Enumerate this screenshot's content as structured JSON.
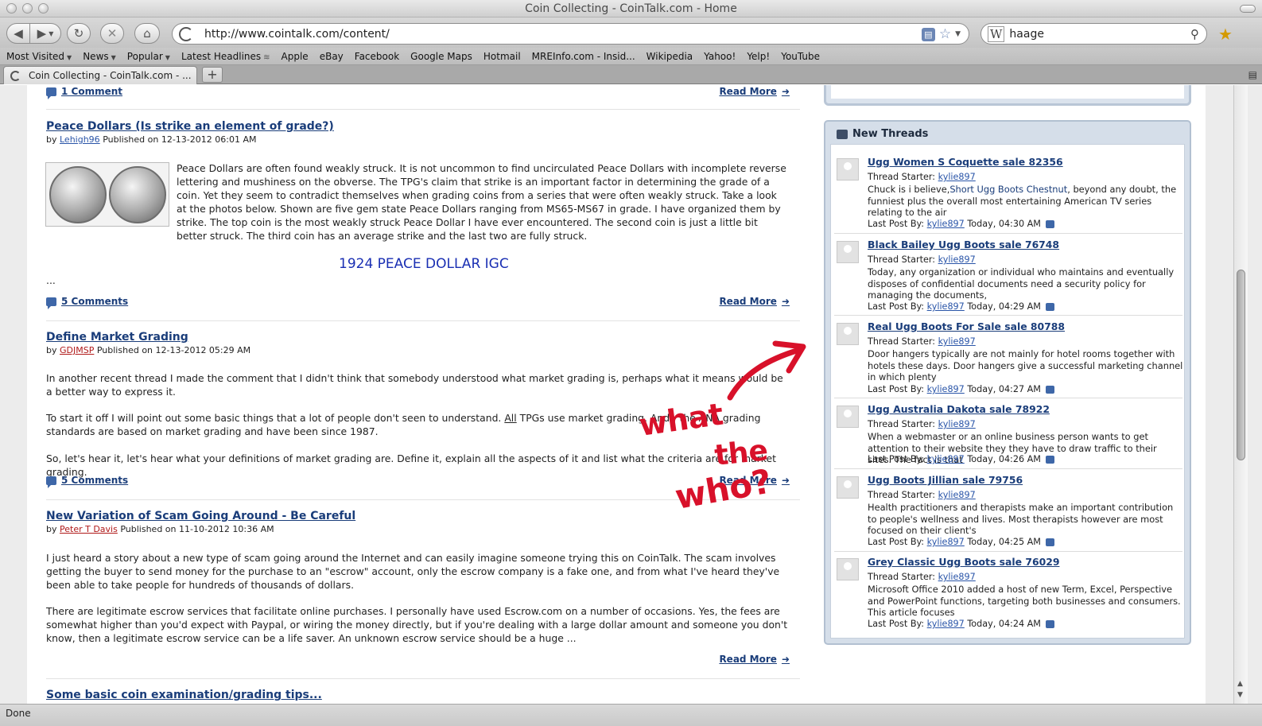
{
  "window": {
    "title": "Coin Collecting - CoinTalk.com - Home"
  },
  "toolbar": {
    "url": "http://www.cointalk.com/content/",
    "search_value": "haage",
    "search_engine_glyph": "W",
    "rss_glyph": "▤"
  },
  "bookmarks": {
    "items": [
      "Most Visited",
      "News",
      "Popular",
      "Latest Headlines",
      "Apple",
      "eBay",
      "Facebook",
      "Google Maps",
      "Hotmail",
      "MREInfo.com - Insid...",
      "Wikipedia",
      "Yahoo!",
      "Yelp!",
      "YouTube"
    ]
  },
  "tabs": {
    "active_label": "Coin Collecting - CoinTalk.com - ...",
    "new_tab": "+"
  },
  "status": {
    "text": "Done"
  },
  "articles": {
    "top_comments": "1 Comment",
    "read_more": "Read More",
    "items": [
      {
        "title": "Peace Dollars (Is strike an element of grade?)",
        "by": "by",
        "author": "Lehigh96",
        "published": "Published on 12-13-2012 06:01 AM",
        "body": "Peace Dollars are often found weakly struck. It is not uncommon to find uncirculated Peace Dollars with incomplete reverse lettering and mushiness on the obverse. The TPG's claim that strike is an important factor in determining the grade of a coin. Yet they seem to contradict themselves when grading coins from a series that were often weakly struck. Take a look at the photos below. Shown are five gem state Peace Dollars ranging from MS65-MS67 in grade. I have organized them by strike. The top coin is the most weakly struck Peace Dollar I have ever encountered. The second coin is just a little bit better struck. The third coin has an average strike and the last two are fully struck.",
        "link_text": "1924 PEACE DOLLAR IGC",
        "ellipsis": "...",
        "comments": "5 Comments"
      },
      {
        "title": "Define Market Grading",
        "by": "by",
        "author": "GDJMSP",
        "published": "Published on 12-13-2012 05:29 AM",
        "para1": "In another recent thread I made the comment that I didn't think that somebody understood what market grading is, perhaps what it means would be a better way to express it.",
        "para2_start": "To start it off I will point out some basic things that a lot of people don't seen to understand. ",
        "para2_all": "All",
        "para2_end": " TPGs use market grading. And - the ANA grading standards are based on market grading and have been since 1987.",
        "para3": "So, let's hear it, let's hear what your definitions of market grading are. Define it, explain all the aspects of it and list what the criteria are for market grading.",
        "comments": "5 Comments"
      },
      {
        "title": "New Variation of Scam Going Around - Be Careful",
        "by": "by",
        "author": "Peter T Davis",
        "published": "Published on 11-10-2012 10:36 AM",
        "para1": "I just heard a story about a new type of scam going around the Internet and can easily imagine someone trying this on CoinTalk. The scam involves getting the buyer to send money for the purchase to an \"escrow\" account, only the escrow company is a fake one, and from what I've heard they've been able to take people for hundreds of thousands of dollars.",
        "para2": "There are legitimate escrow services that facilitate online purchases. I personally have used Escrow.com on a number of occasions. Yes, the fees are somewhat higher than you'd expect with Paypal, or wiring the money directly, but if you're dealing with a large dollar amount and someone you don't know, then a legitimate escrow service can be a life saver. An unknown escrow service should be a huge ..."
      },
      {
        "title": "Some basic coin examination/grading tips..."
      }
    ]
  },
  "sidebar": {
    "heading": "New Threads",
    "starter_label": "Thread Starter:",
    "last_label": "Last Post By:",
    "threads": [
      {
        "title": "Ugg Women S Coquette sale 82356",
        "starter": "kylie897",
        "excerpt_a": "Chuck is i believe,",
        "excerpt_link": "Short Ugg Boots Chestnut",
        "excerpt_b": ", beyond any doubt, the funniest plus the overall most entertaining American TV series relating to the air",
        "last_by": "kylie897",
        "time": "Today, 04:30 AM"
      },
      {
        "title": "Black Bailey Ugg Boots sale 76748",
        "starter": "kylie897",
        "excerpt_a": "Today, any organization or individual who maintains and eventually disposes of confidential documents need a security policy for managing the documents,",
        "excerpt_link": "",
        "excerpt_b": "",
        "last_by": "kylie897",
        "time": "Today, 04:29 AM"
      },
      {
        "title": "Real Ugg Boots For Sale sale 80788",
        "starter": "kylie897",
        "excerpt_a": "Door hangers typically are not mainly for hotel rooms together with hotels these days. Door hangers give a successful marketing channel in which plenty",
        "excerpt_link": "",
        "excerpt_b": "",
        "last_by": "kylie897",
        "time": "Today, 04:27 AM"
      },
      {
        "title": "Ugg Australia Dakota sale 78922",
        "starter": "kylie897",
        "excerpt_a": "When a webmaster or an online business person wants to get attention to their website they they have to draw traffic to their sites. The fact is that",
        "excerpt_link": "",
        "excerpt_b": "",
        "last_by": "kylie897",
        "time": "Today, 04:26 AM"
      },
      {
        "title": "Ugg Boots Jillian sale 79756",
        "starter": "kylie897",
        "excerpt_a": "Health practitioners and therapists make an important contribution to people's wellness and lives. Most therapists however are most focused on their client's",
        "excerpt_link": "",
        "excerpt_b": "",
        "last_by": "kylie897",
        "time": "Today, 04:25 AM"
      },
      {
        "title": "Grey Classic Ugg Boots sale 76029",
        "starter": "kylie897",
        "excerpt_a": "Microsoft Office 2010 added a host of new Term, Excel, Perspective and PowerPoint functions, targeting both businesses and consumers. This article focuses",
        "excerpt_link": "",
        "excerpt_b": "",
        "last_by": "kylie897",
        "time": "Today, 04:24 AM"
      }
    ]
  },
  "annotation": {
    "text": "what the who?",
    "color": "#d8112a"
  }
}
